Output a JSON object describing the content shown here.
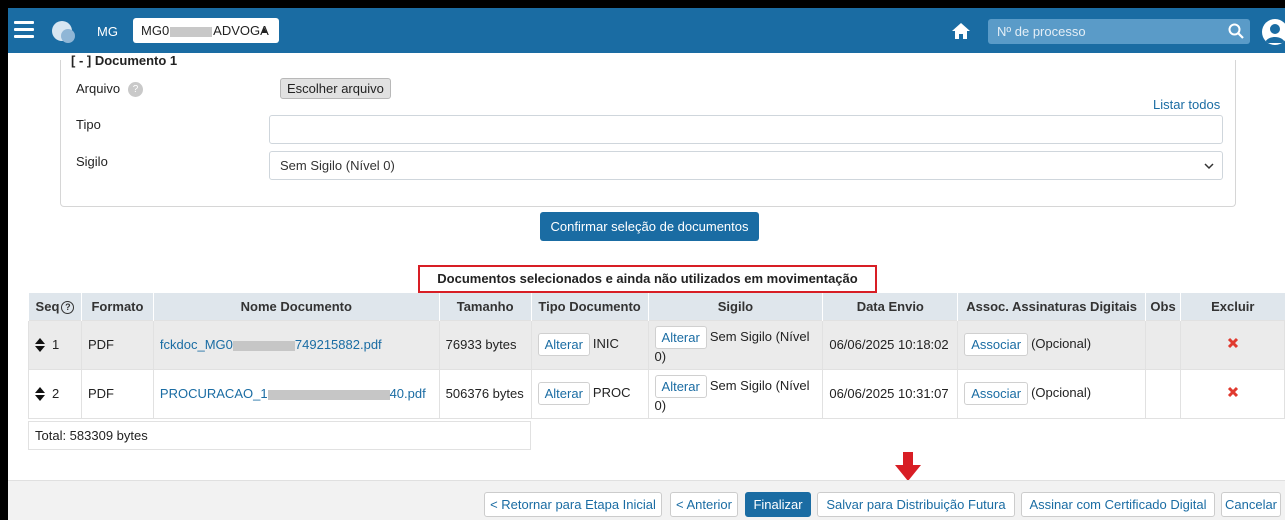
{
  "topbar": {
    "state": "MG",
    "office_prefix": "MG0",
    "office_suffix": "ADVOGA",
    "search_placeholder": "Nº de processo"
  },
  "document_form": {
    "title": "[ - ] Documento 1",
    "arquivo_label": "Arquivo",
    "file_button": "Escolher arquivo",
    "listar_todos": "Listar todos",
    "tipo_label": "Tipo",
    "tipo_value": "",
    "sigilo_label": "Sigilo",
    "sigilo_value": "Sem Sigilo (Nível 0)",
    "confirm_button": "Confirmar seleção de documentos"
  },
  "selected_heading": "Documentos selecionados e ainda não utilizados em movimentação",
  "table": {
    "columns": [
      "Seq",
      "Formato",
      "Nome Documento",
      "Tamanho",
      "Tipo Documento",
      "Sigilo",
      "Data Envio",
      "Assoc. Assinaturas Digitais",
      "Obs",
      "Excluir"
    ],
    "rows": [
      {
        "seq": "1",
        "formato": "PDF",
        "nome_prefix": "fckdoc_MG0",
        "nome_suffix": "749215882.pdf",
        "tamanho": "76933 bytes",
        "alterar": "Alterar",
        "tipo": "INIC",
        "sigilo": "Sem Sigilo (Nível 0)",
        "data_envio": "06/06/2025 10:18:02",
        "associar": "Associar",
        "opcional": "(Opcional)"
      },
      {
        "seq": "2",
        "formato": "PDF",
        "nome_prefix": "PROCURACAO_1",
        "nome_suffix": "40.pdf",
        "tamanho": "506376 bytes",
        "alterar": "Alterar",
        "tipo": "PROC",
        "sigilo": "Sem Sigilo (Nível 0)",
        "data_envio": "06/06/2025 10:31:07",
        "associar": "Associar",
        "opcional": "(Opcional)"
      }
    ],
    "total": "Total: 583309 bytes"
  },
  "bottom_buttons": {
    "retornar": "< Retornar para Etapa Inicial",
    "anterior": "< Anterior",
    "finalizar": "Finalizar",
    "salvar": "Salvar para Distribuição Futura",
    "assinar": "Assinar com Certificado Digital",
    "cancelar": "Cancelar"
  },
  "colors": {
    "brand": "#1a6ca3",
    "highlight_border": "#d81e25",
    "delete_icon": "#e03a2f"
  }
}
